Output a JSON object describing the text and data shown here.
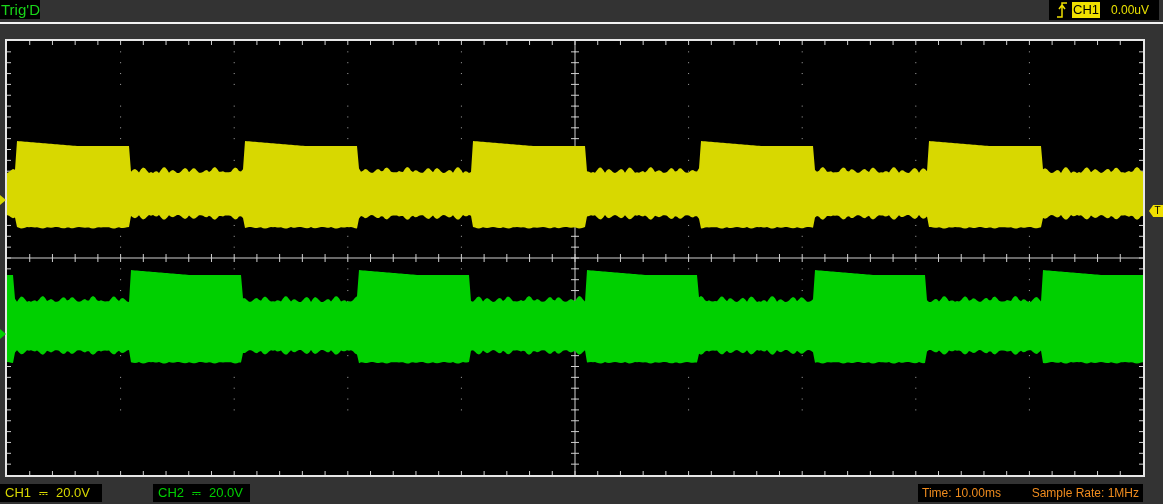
{
  "status": {
    "trigger_state": "Trig'D"
  },
  "trigger": {
    "channel": "CH1",
    "level": "0.00uV"
  },
  "scope": {
    "trigger_marker": "T",
    "channels": [
      {
        "color": "#d8d800"
      },
      {
        "color": "#00d000"
      }
    ]
  },
  "readouts": [
    {
      "channel": "CH1",
      "coupling": "⎓",
      "scale": "20.0V"
    },
    {
      "channel": "CH2",
      "coupling": "⎓",
      "scale": "20.0V"
    }
  ],
  "timebase": {
    "time": "Time: 10.00ms",
    "sample_rate": "Sample Rate: 1MHz"
  }
}
